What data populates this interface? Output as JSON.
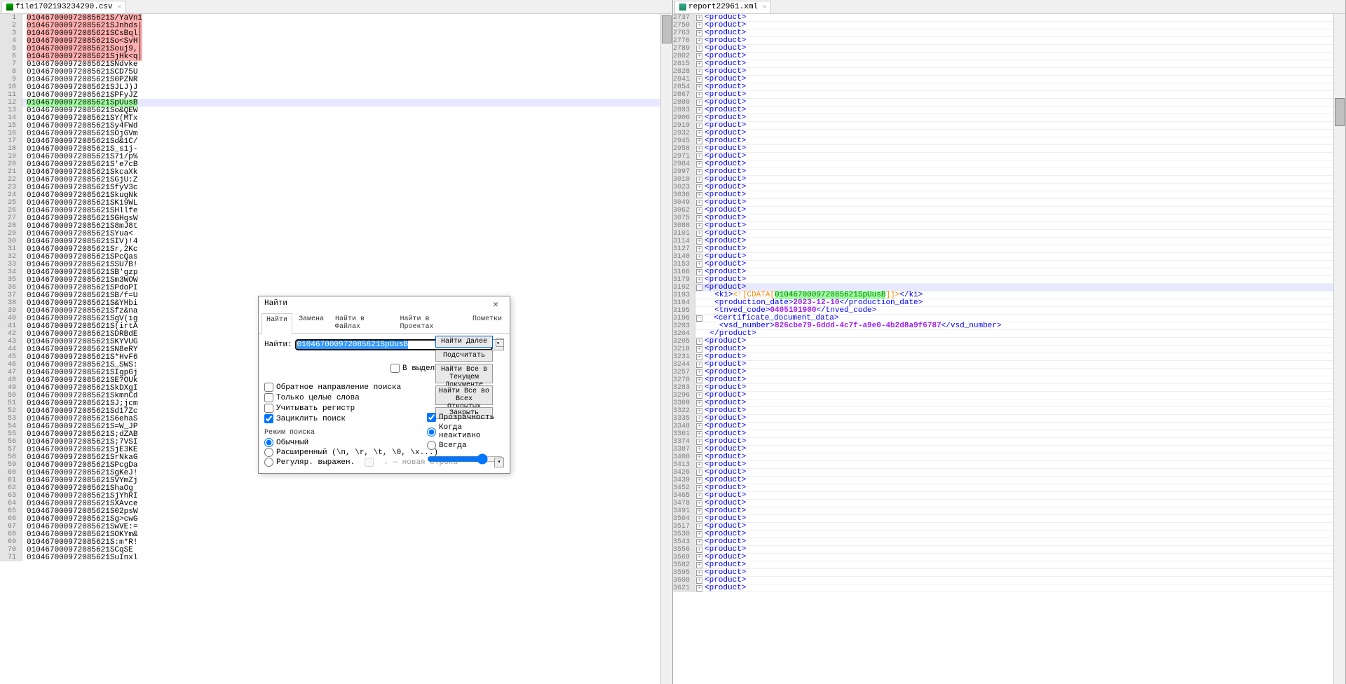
{
  "left": {
    "tab": "file1702193234290.csv",
    "lines": [
      {
        "n": 1,
        "t": "010467000972085621S/YaVn1",
        "m": "orange",
        "hl": "red"
      },
      {
        "n": 2,
        "t": "010467000972085621SJnhds|",
        "m": "orange",
        "hl": "red"
      },
      {
        "n": 3,
        "t": "010467000972085621SCsBql|",
        "m": "orange",
        "hl": "red"
      },
      {
        "n": 4,
        "t": "010467000972085621So<SvH|",
        "m": "orange",
        "hl": "red"
      },
      {
        "n": 5,
        "t": "010467000972085621Souj9,|",
        "m": "orange",
        "hl": "red"
      },
      {
        "n": 6,
        "t": "010467000972085621SjHk<q|",
        "m": "orange",
        "hl": "red"
      },
      {
        "n": 7,
        "t": "010467000972085621SNdvke"
      },
      {
        "n": 8,
        "t": "010467000972085621SCD75U"
      },
      {
        "n": 9,
        "t": "010467000972085621S0PZNR"
      },
      {
        "n": 10,
        "t": "010467000972085621SJLJ)J"
      },
      {
        "n": 11,
        "t": "010467000972085621SPFyJZ"
      },
      {
        "n": 12,
        "t": "010467000972085621SpUusB",
        "hl": "green",
        "line": true
      },
      {
        "n": 13,
        "t": "010467000972085621So&QEW"
      },
      {
        "n": 14,
        "t": "010467000972085621SY(MTx"
      },
      {
        "n": 15,
        "t": "010467000972085621Sy4FWd"
      },
      {
        "n": 16,
        "t": "010467000972085621SOjGVm"
      },
      {
        "n": 17,
        "t": "010467000972085621Sd&1C/",
        "m": "orange"
      },
      {
        "n": 18,
        "t": "010467000972085621S_s1j-",
        "m": "orange"
      },
      {
        "n": 19,
        "t": "010467000972085621S71/p%"
      },
      {
        "n": 20,
        "t": "010467000972085621S'e7cB",
        "m": "orange"
      },
      {
        "n": 21,
        "t": "010467000972085621SkcaXk"
      },
      {
        "n": 22,
        "t": "010467000972085621SGjU:Z",
        "m": "orange"
      },
      {
        "n": 23,
        "t": "010467000972085621SfyV3c",
        "m": "orange"
      },
      {
        "n": 24,
        "t": "010467000972085621SkugNk",
        "m": "orange"
      },
      {
        "n": 25,
        "t": "010467000972085621SK19WL",
        "m": "orange"
      },
      {
        "n": 26,
        "t": "010467000972085621SHllfe"
      },
      {
        "n": 27,
        "t": "010467000972085621SGHgsW"
      },
      {
        "n": 28,
        "t": "010467000972085621S8mJ8t"
      },
      {
        "n": 29,
        "t": "010467000972085621SYua<"
      },
      {
        "n": 30,
        "t": "010467000972085621SIV)!4"
      },
      {
        "n": 31,
        "t": "010467000972085621Sr,2Kc",
        "m": "orange"
      },
      {
        "n": 32,
        "t": "010467000972085621SPcQas"
      },
      {
        "n": 33,
        "t": "010467000972085621SSU7B!",
        "m": "orange"
      },
      {
        "n": 34,
        "t": "010467000972085621SB'gzp"
      },
      {
        "n": 35,
        "t": "010467000972085621Sm3WOW"
      },
      {
        "n": 36,
        "t": "010467000972085621SPdoPI",
        "m": "orange"
      },
      {
        "n": 37,
        "t": "010467000972085621SB/f=U"
      },
      {
        "n": 38,
        "t": "010467000972085621S&YHbi"
      },
      {
        "n": 39,
        "t": "010467000972085621Sfz&na"
      },
      {
        "n": 40,
        "t": "010467000972085621SgV(ig"
      },
      {
        "n": 41,
        "t": "010467000972085621S(irtA"
      },
      {
        "n": 42,
        "t": "010467000972085621SDRBdE"
      },
      {
        "n": 43,
        "t": "010467000972085621SKYVUG"
      },
      {
        "n": 44,
        "t": "010467000972085621SN8eRY"
      },
      {
        "n": 45,
        "t": "010467000972085621S*HvF6",
        "m": "orange"
      },
      {
        "n": 46,
        "t": "010467000972085621S_SWS:",
        "m": "orange"
      },
      {
        "n": 47,
        "t": "010467000972085621SIgpGj"
      },
      {
        "n": 48,
        "t": "010467000972085621SE?OUk",
        "m": "orange"
      },
      {
        "n": 49,
        "t": "010467000972085621SkDXgI"
      },
      {
        "n": 50,
        "t": "010467000972085621SkmnCd",
        "m": "orange"
      },
      {
        "n": 51,
        "t": "010467000972085621SJ;jcm",
        "m": "orange"
      },
      {
        "n": 52,
        "t": "010467000972085621Sd17Zc"
      },
      {
        "n": 53,
        "t": "010467000972085621S6ehaS"
      },
      {
        "n": 54,
        "t": "010467000972085621S=W_JP",
        "m": "orange"
      },
      {
        "n": 55,
        "t": "010467000972085621S;dZAB",
        "m": "orange"
      },
      {
        "n": 56,
        "t": "010467000972085621S;7VSI",
        "m": "orange"
      },
      {
        "n": 57,
        "t": "010467000972085621SjE3KE"
      },
      {
        "n": 58,
        "t": "010467000972085621SrNkaG"
      },
      {
        "n": 59,
        "t": "010467000972085621SPcgDa"
      },
      {
        "n": 60,
        "t": "010467000972085621SgKeJ!"
      },
      {
        "n": 61,
        "t": "010467000972085621SVYmZj"
      },
      {
        "n": 62,
        "t": "010467000972085621ShaOg"
      },
      {
        "n": 63,
        "t": "010467000972085621SjYhRI"
      },
      {
        "n": 64,
        "t": "010467000972085621SXAvce"
      },
      {
        "n": 65,
        "t": "010467000972085621S02psW"
      },
      {
        "n": 66,
        "t": "010467000972085621Sg>cwG"
      },
      {
        "n": 67,
        "t": "010467000972085621SwVE:="
      },
      {
        "n": 68,
        "t": "010467000972085621SOKYm&"
      },
      {
        "n": 69,
        "t": "010467000972085621S:m*R!",
        "m": "orange"
      },
      {
        "n": 70,
        "t": "010467000972085621SCqSE"
      },
      {
        "n": 71,
        "t": "010467000972085621SuInxl"
      }
    ]
  },
  "right": {
    "tab": "report22961.xml",
    "prefix_nums": [
      2737,
      2750,
      2763,
      2776,
      2789,
      2802,
      2815,
      2828,
      2841,
      2854,
      2867,
      2880,
      2893,
      2906,
      2919,
      2932,
      2945,
      2958,
      2971,
      2984,
      2997,
      3010,
      3023,
      3036,
      3049,
      3062,
      3075,
      3088,
      3101,
      3114,
      3127,
      3140,
      3153,
      3166,
      3179
    ],
    "open_num": 3192,
    "detail": {
      "ki_num": 3193,
      "ki_cdata": "010467000972085621SpUusB",
      "prod_date_num": 3194,
      "prod_date": "2023-12-10",
      "tnved_num": 3195,
      "tnved": "0405101900",
      "cert_num": 3196,
      "vsd_num": 3203,
      "vsd": "826cbe79-6ddd-4c7f-a9e0-4b2d8a9f6787",
      "close_num": 3204
    },
    "suffix_nums": [
      3205,
      3218,
      3231,
      3244,
      3257,
      3270,
      3283,
      3296,
      3309,
      3322,
      3335,
      3348,
      3361,
      3374,
      3387,
      3400,
      3413,
      3426,
      3439,
      3452,
      3465,
      3478,
      3491,
      3504,
      3517,
      3530,
      3543,
      3556,
      3569,
      3582,
      3595,
      3608,
      3621
    ],
    "product_tag": "<product>"
  },
  "dlg": {
    "title": "Найти",
    "tabs": [
      "Найти",
      "Замена",
      "Найти в Файлах",
      "Найти в Проектах",
      "Пометки"
    ],
    "label_find": "Найти:",
    "value": "010467000972085621SpUusB",
    "btn_next": "Найти Далее",
    "btn_count": "Подсчитать",
    "btn_allcur": "Найти Все в Текущем Документе",
    "btn_allopen": "Найти Все во Всех Открытых Документах",
    "btn_close": "Закрыть",
    "sel_only": "В выделенном",
    "chk_back": "Обратное направление поиска",
    "chk_whole": "Только целые слова",
    "chk_case": "Учитывать регистр",
    "chk_loop": "Зациклить поиск",
    "mode_title": "Режим поиска",
    "mode_normal": "Обычный",
    "mode_ext": "Расширенный (\\n, \\r, \\t, \\0, \\x...)",
    "mode_regex": "Регуляр. выражен.",
    "mode_regex_note": ". — новая строка",
    "trans_title": "Прозрачность",
    "trans_inactive": "Когда неактивно",
    "trans_always": "Всегда"
  }
}
